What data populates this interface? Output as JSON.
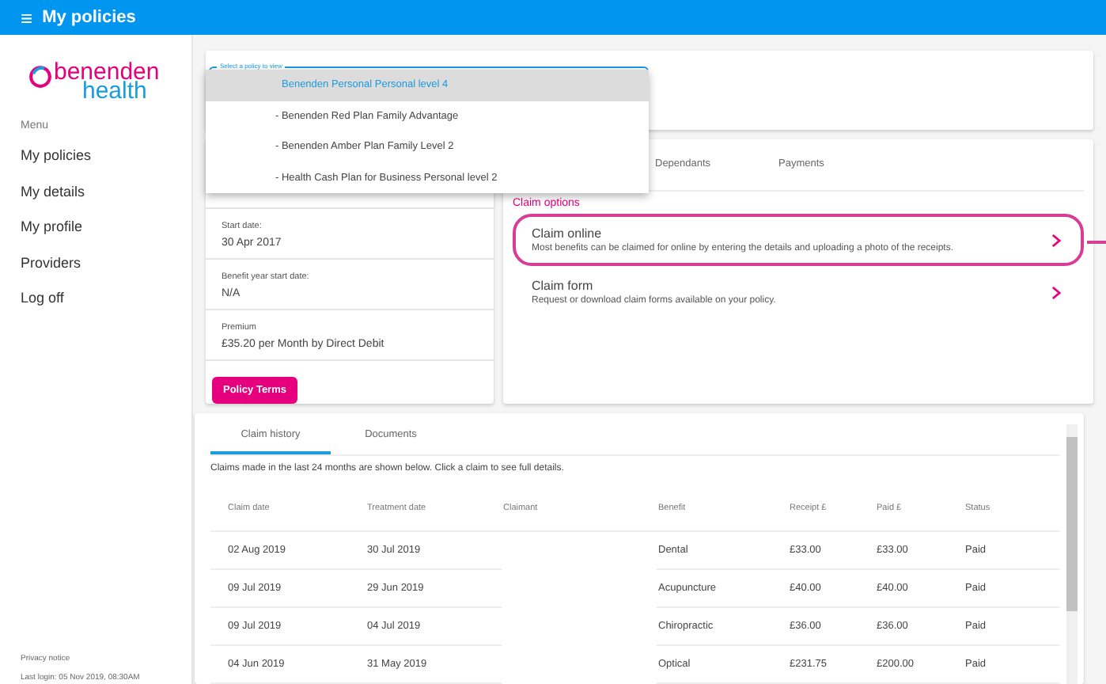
{
  "app_bar": {
    "menu_icon": "≡",
    "title": "My policies"
  },
  "logo": {
    "brand": "benenden",
    "sub": "health"
  },
  "sidebar": {
    "heading": "Menu",
    "items": [
      {
        "label": "My policies"
      },
      {
        "label": "My details"
      },
      {
        "label": "My profile"
      },
      {
        "label": "Providers"
      },
      {
        "label": "Log off"
      }
    ],
    "footer_link": "Privacy notice",
    "last_login": "Last login: 05 Nov 2019, 08:30AM"
  },
  "policy_select": {
    "label": "Select a policy to view",
    "options": [
      {
        "label": "Benenden Personal Personal level 4",
        "selected": true
      },
      {
        "label": "- Benenden Red Plan Family Advantage",
        "selected": false
      },
      {
        "label": "- Benenden Amber Plan Family Level 2",
        "selected": false
      },
      {
        "label": "- Health Cash Plan for Business Personal level 2",
        "selected": false
      }
    ]
  },
  "policy_details": {
    "fields": [
      {
        "label": "Start date:",
        "value": "30 Apr 2017"
      },
      {
        "label": "Benefit year start date:",
        "value": "N/A"
      },
      {
        "label": "Premium",
        "value": "£35.20 per Month by Direct Debit"
      }
    ],
    "button": "Policy Terms"
  },
  "claims_panel": {
    "tabs": [
      {
        "label": "Dependants",
        "selected": false
      },
      {
        "label": "Payments",
        "selected": false
      }
    ],
    "heading": "Claim options",
    "options": [
      {
        "title": "Claim online",
        "description": "Most benefits can be claimed for online by entering the details and uploading a photo of the receipts.",
        "highlighted": true
      },
      {
        "title": "Claim form",
        "description": "Request or download claim forms available on your policy.",
        "highlighted": false
      }
    ]
  },
  "history": {
    "tabs": [
      {
        "label": "Claim history",
        "selected": true
      },
      {
        "label": "Documents",
        "selected": false
      }
    ],
    "intro": "Claims made in the last 24 months are shown below. Click a claim to see full details.",
    "columns": [
      "Claim date",
      "Treatment date",
      "Claimant",
      "Benefit",
      "Receipt £",
      "Paid £",
      "Status"
    ],
    "rows": [
      [
        "02 Aug 2019",
        "30 Jul 2019",
        "",
        "Dental",
        "£33.00",
        "£33.00",
        "Paid"
      ],
      [
        "09 Jul 2019",
        "29 Jun 2019",
        "",
        "Acupuncture",
        "£40.00",
        "£40.00",
        "Paid"
      ],
      [
        "09 Jul 2019",
        "04 Jul 2019",
        "",
        "Chiropractic",
        "£36.00",
        "£36.00",
        "Paid"
      ],
      [
        "04 Jun 2019",
        "31 May 2019",
        "",
        "Optical",
        "£231.75",
        "£200.00",
        "Paid"
      ]
    ]
  }
}
